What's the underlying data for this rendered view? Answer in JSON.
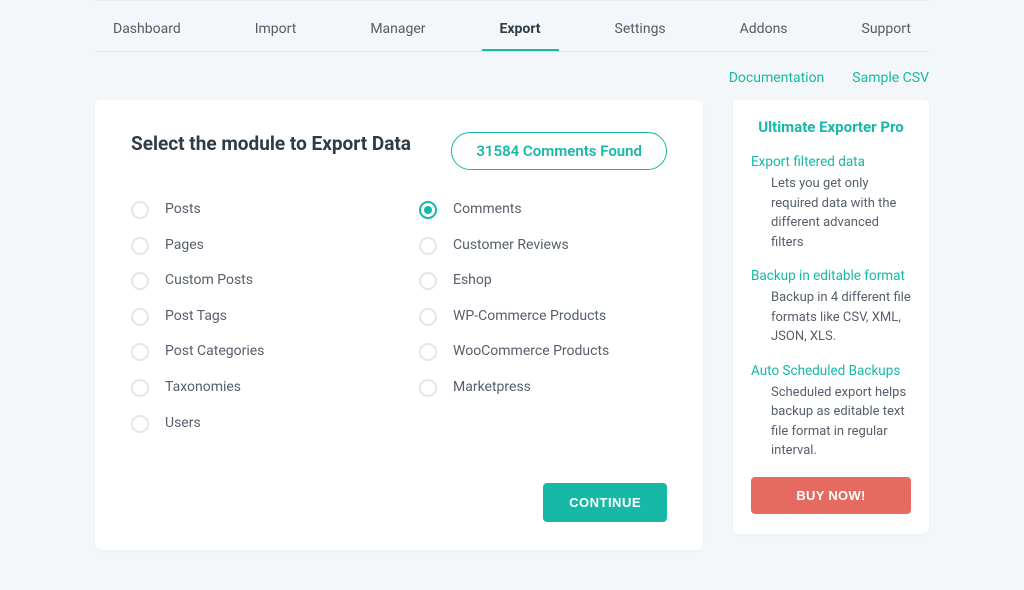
{
  "tabs": [
    {
      "label": "Dashboard",
      "active": false
    },
    {
      "label": "Import",
      "active": false
    },
    {
      "label": "Manager",
      "active": false
    },
    {
      "label": "Export",
      "active": true
    },
    {
      "label": "Settings",
      "active": false
    },
    {
      "label": "Addons",
      "active": false
    },
    {
      "label": "Support",
      "active": false
    }
  ],
  "doclinks": {
    "documentation": "Documentation",
    "sample_csv": "Sample CSV"
  },
  "main": {
    "title": "Select the module to Export Data",
    "count_pill": "31584 Comments Found",
    "continue": "CONTINUE"
  },
  "modules_left": [
    {
      "label": "Posts"
    },
    {
      "label": "Pages"
    },
    {
      "label": "Custom Posts"
    },
    {
      "label": "Post Tags"
    },
    {
      "label": "Post Categories"
    },
    {
      "label": "Taxonomies"
    },
    {
      "label": "Users"
    }
  ],
  "modules_right": [
    {
      "label": "Comments",
      "selected": true
    },
    {
      "label": "Customer Reviews"
    },
    {
      "label": "Eshop"
    },
    {
      "label": "WP-Commerce Products"
    },
    {
      "label": "WooCommerce Products"
    },
    {
      "label": "Marketpress"
    }
  ],
  "sidebar": {
    "title": "Ultimate Exporter Pro",
    "features": [
      {
        "title": "Export filtered data",
        "desc": "Lets you get only required data with the different advanced filters"
      },
      {
        "title": "Backup in editable format",
        "desc": "Backup in 4 different file formats like CSV, XML, JSON, XLS."
      },
      {
        "title": "Auto Scheduled Backups",
        "desc": "Scheduled export helps backup as editable text file format in regular interval."
      }
    ],
    "buy": "BUY NOW!"
  }
}
